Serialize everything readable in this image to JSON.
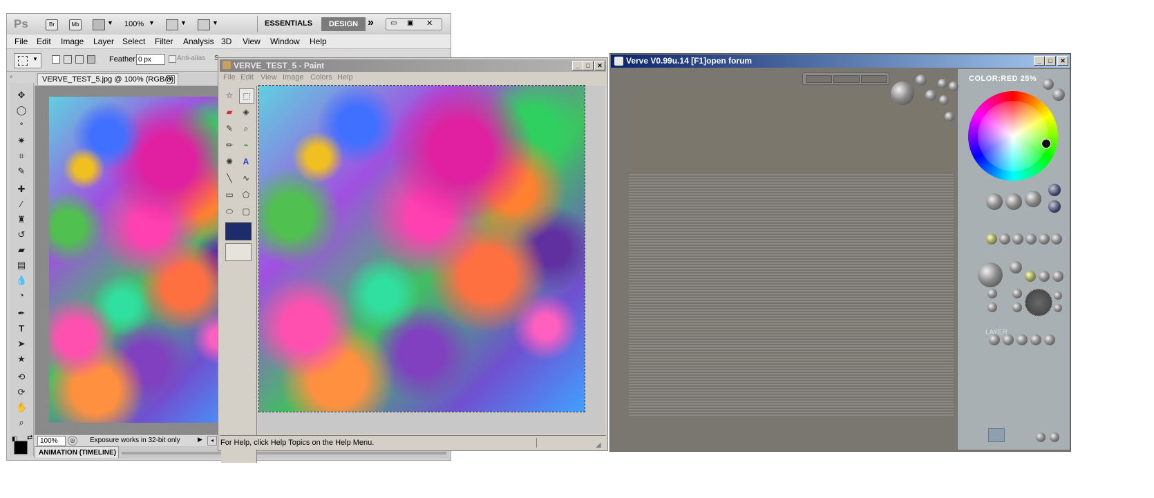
{
  "photoshop": {
    "logo": "Ps",
    "toolbar": {
      "br_label": "Br",
      "mb_label": "Mb",
      "zoom": "100%",
      "essentials": "ESSENTIALS",
      "design": "DESIGN",
      "more": "»"
    },
    "menu": [
      "File",
      "Edit",
      "Image",
      "Layer",
      "Select",
      "Filter",
      "Analysis",
      "3D",
      "View",
      "Window",
      "Help"
    ],
    "options": {
      "feather_label": "Feather:",
      "feather_value": "0 px",
      "antialias_label": "Anti-alias"
    },
    "doc_tab": "VERVE_TEST_5.jpg @ 100% (RGB/8)",
    "status": {
      "zoom": "100%",
      "message": "Exposure works in 32-bit only"
    },
    "animation_tab": "ANIMATION (TIMELINE)"
  },
  "paint": {
    "title": "VERVE_TEST_5 - Paint",
    "menu": [
      "File",
      "Edit",
      "View",
      "Image",
      "Colors",
      "Help"
    ],
    "status": "For Help, click Help Topics on the Help Menu."
  },
  "verve": {
    "title": "Verve V0.99u.14 [F1]open forum",
    "color_label": "COLOR:RED  25%",
    "layer_label": "LAYER"
  },
  "colors": {
    "ps_design_bg": "#7b7b7b",
    "verve_title_start": "#0a246a",
    "paint_title": "#848284"
  }
}
